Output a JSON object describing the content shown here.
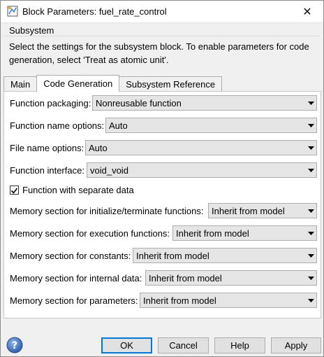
{
  "window": {
    "title": "Block Parameters: fuel_rate_control",
    "close_symbol": "✕"
  },
  "group": {
    "label": "Subsystem",
    "description": "Select the settings for the subsystem block. To enable parameters for code generation, select 'Treat as atomic unit'."
  },
  "tabs": [
    {
      "label": "Main",
      "active": false
    },
    {
      "label": "Code Generation",
      "active": true
    },
    {
      "label": "Subsystem Reference",
      "active": false
    }
  ],
  "fields": {
    "function_packaging": {
      "label": "Function packaging:",
      "value": "Nonreusable function"
    },
    "function_name_options": {
      "label": "Function name options:",
      "value": "Auto"
    },
    "file_name_options": {
      "label": "File name options:",
      "value": "Auto"
    },
    "function_interface": {
      "label": "Function interface:",
      "value": "void_void"
    },
    "separate_data": {
      "label": "Function with separate data",
      "checked": true
    },
    "mem_init_term": {
      "label": "Memory section for initialize/terminate functions:",
      "value": "Inherit from model"
    },
    "mem_exec": {
      "label": "Memory section for execution functions:",
      "value": "Inherit from model"
    },
    "mem_constants": {
      "label": "Memory section for constants:",
      "value": "Inherit from model"
    },
    "mem_internal": {
      "label": "Memory section for internal data:",
      "value": "Inherit from model"
    },
    "mem_params": {
      "label": "Memory section for parameters:",
      "value": "Inherit from model"
    }
  },
  "buttons": {
    "ok": "OK",
    "cancel": "Cancel",
    "help": "Help",
    "apply": "Apply"
  },
  "icons": {
    "caret": "dropdown-caret-icon",
    "help": "help-question-icon",
    "app": "simulink-block-icon"
  },
  "colors": {
    "accent": "#0078d7",
    "help_icon": "#3b6fb6"
  }
}
